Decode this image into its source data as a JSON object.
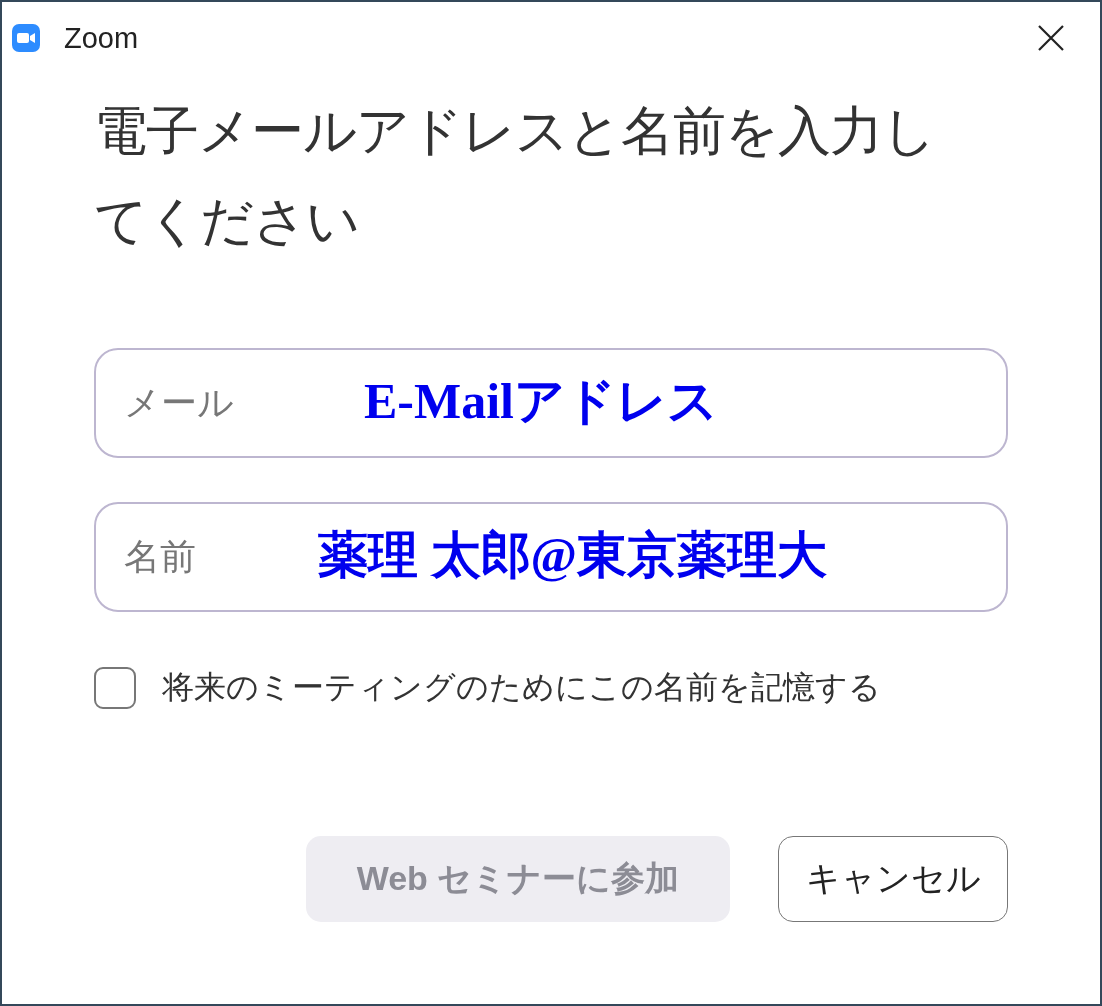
{
  "window": {
    "title": "Zoom"
  },
  "heading": "電子メールアドレスと名前を入力してください",
  "fields": [
    {
      "placeholder": "メール",
      "annotation": "E-Mailアドレス"
    },
    {
      "placeholder": "名前",
      "annotation": "薬理 太郎@東京薬理大"
    }
  ],
  "remember": {
    "label": "将来のミーティングのためにこの名前を記憶する",
    "checked": false
  },
  "buttons": [
    {
      "label": "Web セミナーに参加",
      "kind": "primary",
      "disabled": true
    },
    {
      "label": "キャンセル",
      "kind": "secondary",
      "disabled": false
    }
  ]
}
